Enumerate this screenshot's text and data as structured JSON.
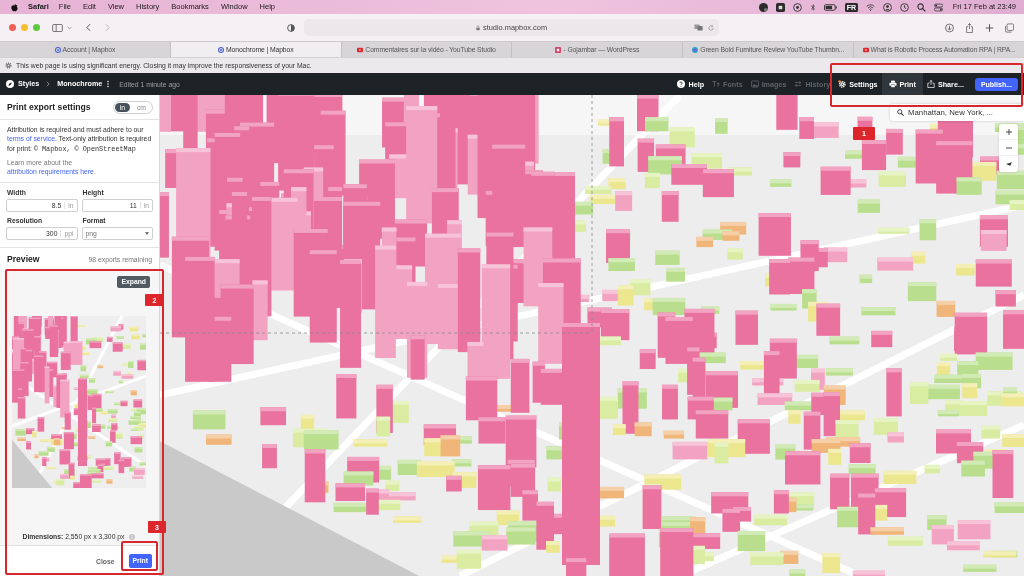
{
  "menu_bar": {
    "app": "Safari",
    "items": [
      "File",
      "Edit",
      "View",
      "History",
      "Bookmarks",
      "Window",
      "Help"
    ],
    "input_source": "FR",
    "clock": "Fri 17 Feb at 23:49"
  },
  "browser": {
    "address": "studio.mapbox.com",
    "tabs": [
      {
        "title": "Account | Mapbox",
        "selected": false
      },
      {
        "title": "Monochrome | Mapbox",
        "selected": true
      },
      {
        "title": "Commentaires sur la vidéo - YouTube Studio",
        "selected": false
      },
      {
        "title": "- Gojambar — WordPress",
        "selected": false
      },
      {
        "title": "Green Bold Furniture Review YouTube Thumbn...",
        "selected": false
      },
      {
        "title": "What is Robotic Process Automation RPA | RPA...",
        "selected": false
      }
    ],
    "energy_notice": "This web page is using significant energy. Closing it may improve the responsiveness of your Mac."
  },
  "studio_header": {
    "breadcrumb": [
      {
        "label": "Styles"
      },
      {
        "label": "Monochrome"
      }
    ],
    "edited": "Edited 1 minute ago",
    "nav": [
      {
        "label": "Help",
        "disabled": false,
        "selected": false
      },
      {
        "label": "Fonts",
        "disabled": true,
        "selected": false
      },
      {
        "label": "Images",
        "disabled": true,
        "selected": false
      },
      {
        "label": "History",
        "disabled": true,
        "selected": false
      },
      {
        "label": "Settings",
        "disabled": false,
        "selected": false
      },
      {
        "label": "Print",
        "disabled": false,
        "selected": true
      },
      {
        "label": "Share...",
        "disabled": false,
        "selected": false
      }
    ],
    "publish": "Publish..."
  },
  "print_panel": {
    "title": "Print export settings",
    "units": [
      {
        "label": "in",
        "selected": true
      },
      {
        "label": "cm",
        "selected": false
      }
    ],
    "attribution": {
      "text": "Attribution is required and must adhere to our",
      "link": "terms of service",
      "text_after": ". Text-only attribution is required for print:",
      "code": "© Mapbox, © OpenStreetMap"
    },
    "learn_more": {
      "text": "Learn more about the",
      "link": "attribution requirements here",
      "text_after": "."
    },
    "fields": [
      {
        "kind": "number",
        "label": "Width",
        "value": "8.5",
        "unit": "in"
      },
      {
        "kind": "number",
        "label": "Height",
        "value": "11",
        "unit": "in"
      },
      {
        "kind": "number",
        "label": "Resolution",
        "value": "300",
        "unit": "ppi"
      },
      {
        "kind": "select",
        "label": "Format",
        "value": "png"
      }
    ],
    "preview": {
      "title": "Preview",
      "remaining": "98 exports remaining",
      "expand": "Expand",
      "dimensions": "**Dimensions:** 2,550 px x 3,300 px"
    },
    "actions": [
      {
        "kind": "secondary",
        "label": "Close"
      },
      {
        "kind": "primary",
        "label": "Print"
      }
    ]
  },
  "map": {
    "search": {
      "value": "Manhattan, New York, ..."
    }
  },
  "annotations": [
    {
      "number": "1"
    },
    {
      "number": "2"
    },
    {
      "number": "3"
    }
  ]
}
